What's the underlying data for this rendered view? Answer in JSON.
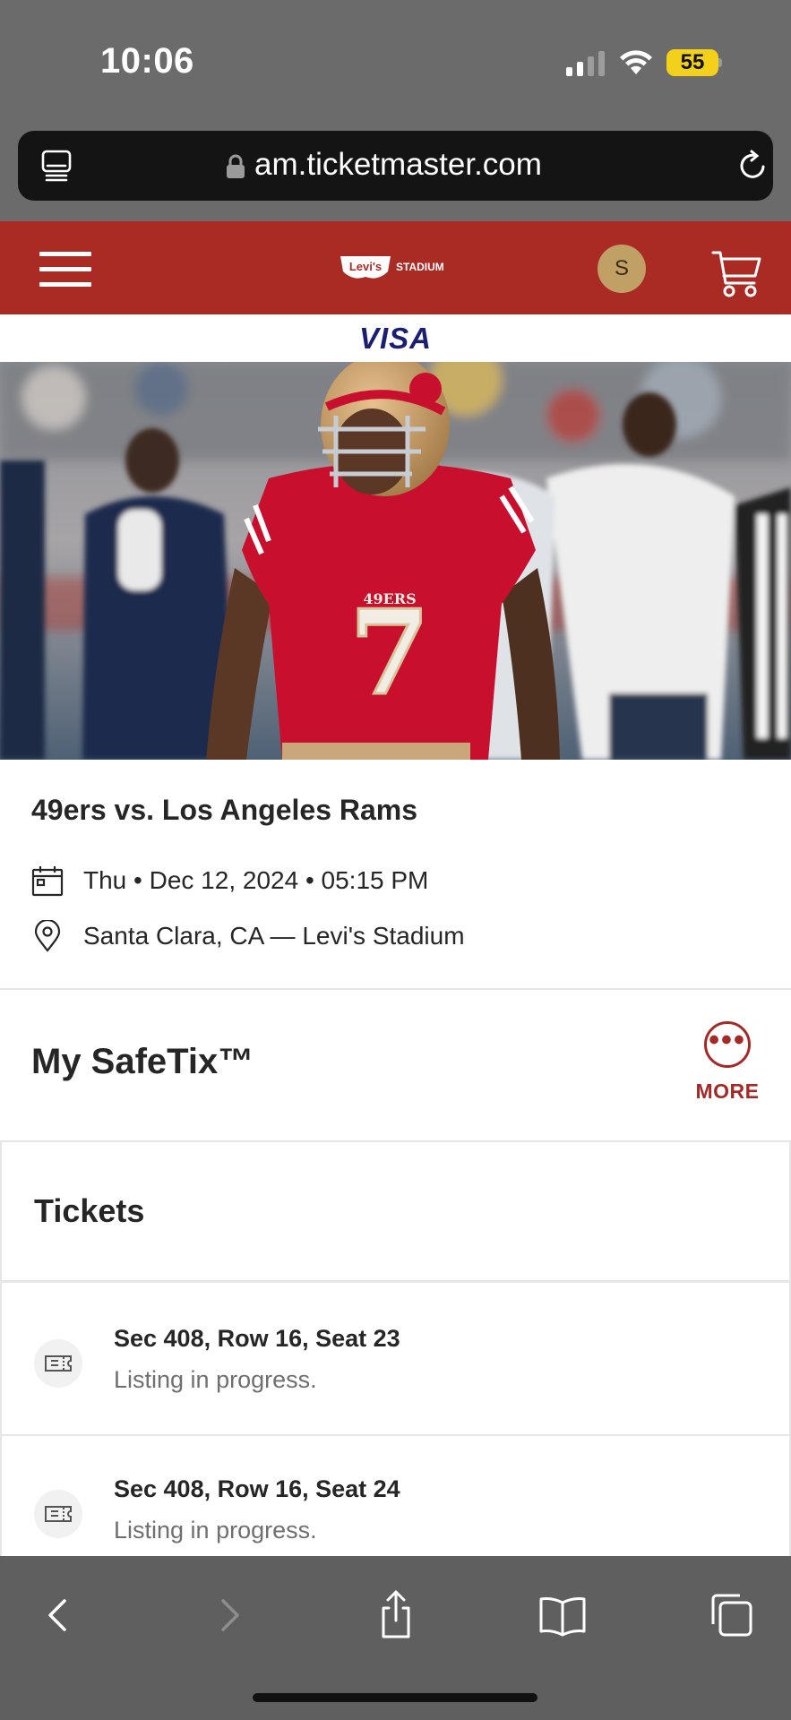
{
  "status_bar": {
    "time": "10:06",
    "battery_level": "55",
    "battery_color": "#f3d11a"
  },
  "browser": {
    "url": "am.ticketmaster.com",
    "icons": [
      "reader-icon",
      "lock-icon",
      "reload-icon"
    ]
  },
  "header": {
    "logo_brand": "Levi's",
    "logo_sub": "STADIUM",
    "avatar_initial": "S",
    "brand_color": "#aa2a24",
    "icons": [
      "menu-icon",
      "cart-icon"
    ]
  },
  "sponsor": {
    "name": "VISA",
    "color": "#1a1f71"
  },
  "hero": {
    "jersey_number": "7",
    "jersey_text": "49ERS"
  },
  "event": {
    "title": "49ers vs. Los Angeles Rams",
    "datetime": "Thu • Dec 12, 2024 • 05:15 PM",
    "location": "Santa Clara, CA — Levi's Stadium",
    "icons": [
      "calendar-icon",
      "location-pin-icon"
    ]
  },
  "safetix": {
    "title": "My SafeTix™",
    "more_label": "MORE",
    "more_dots": "•••",
    "accent_color": "#a32a26"
  },
  "tickets": {
    "title": "Tickets",
    "items": [
      {
        "seat": "Sec 408, Row 16, Seat 23",
        "status": "Listing in progress."
      },
      {
        "seat": "Sec 408, Row 16, Seat 24",
        "status": "Listing in progress."
      }
    ]
  },
  "toolbar": {
    "icons": [
      "back-icon",
      "forward-icon",
      "share-icon",
      "bookmarks-icon",
      "tabs-icon"
    ]
  }
}
